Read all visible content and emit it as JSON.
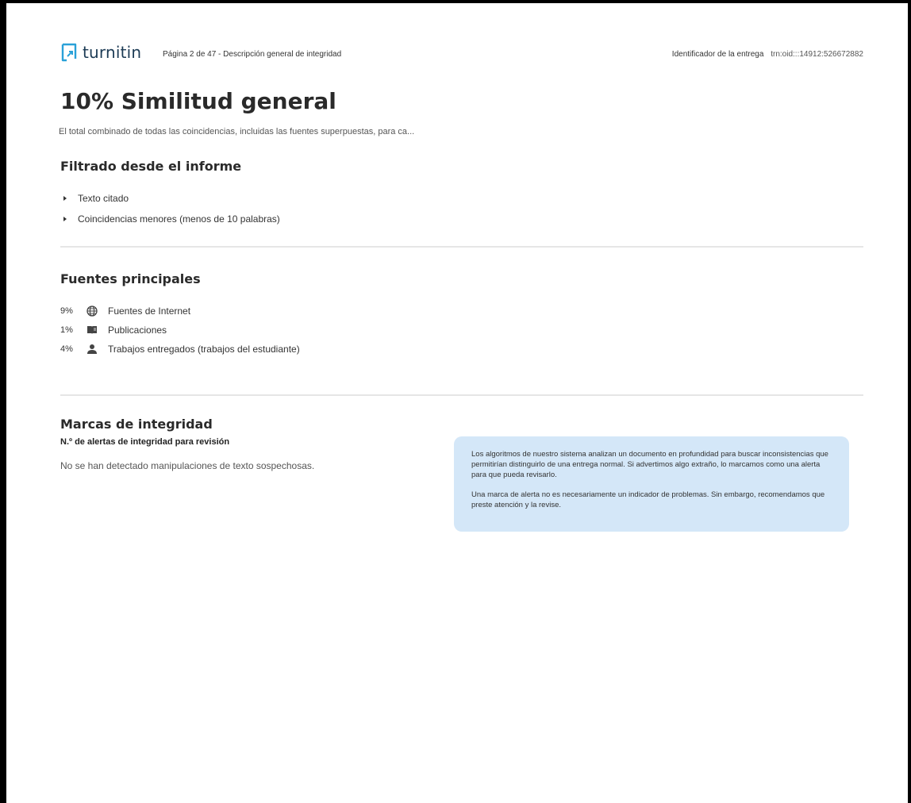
{
  "header": {
    "logo_text": "turnitin",
    "page_info": "Página 2 de 47 - Descripción general de integridad",
    "submission_label": "Identificador de la entrega",
    "submission_id": "trn:oid:::14912:526672882"
  },
  "overview": {
    "title": "10% Similitud general",
    "subtitle": "El total combinado de todas las coincidencias, incluidas las fuentes superpuestas, para ca..."
  },
  "filtered": {
    "heading": "Filtrado desde el informe",
    "items": [
      "Texto citado",
      "Coincidencias menores (menos de 10 palabras)"
    ]
  },
  "sources": {
    "heading": "Fuentes principales",
    "items": [
      {
        "percent": "9%",
        "icon": "globe-icon",
        "label": "Fuentes de Internet"
      },
      {
        "percent": "1%",
        "icon": "book-icon",
        "label": "Publicaciones"
      },
      {
        "percent": "4%",
        "icon": "person-icon",
        "label": "Trabajos entregados (trabajos del estudiante)"
      }
    ]
  },
  "integrity": {
    "heading": "Marcas de integridad",
    "alerts_label": "N.º de alertas de integridad para revisión",
    "alerts_note": "No se han detectado manipulaciones de texto sospechosas.",
    "info_paragraph_1": "Los algoritmos de nuestro sistema analizan un documento en profundidad para buscar inconsistencias que permitirían distinguirlo de una entrega normal. Si advertimos algo extraño, lo marcamos como una alerta para que pueda revisarlo.",
    "info_paragraph_2": "Una marca de alerta no es necesariamente un indicador de problemas. Sin embargo, recomendamos que preste atención y la revise."
  },
  "colors": {
    "brand": "#1c3b55",
    "brand_accent": "#2aa1d8",
    "info_box_bg": "#d4e7f8",
    "divider": "#e6e6e6"
  }
}
